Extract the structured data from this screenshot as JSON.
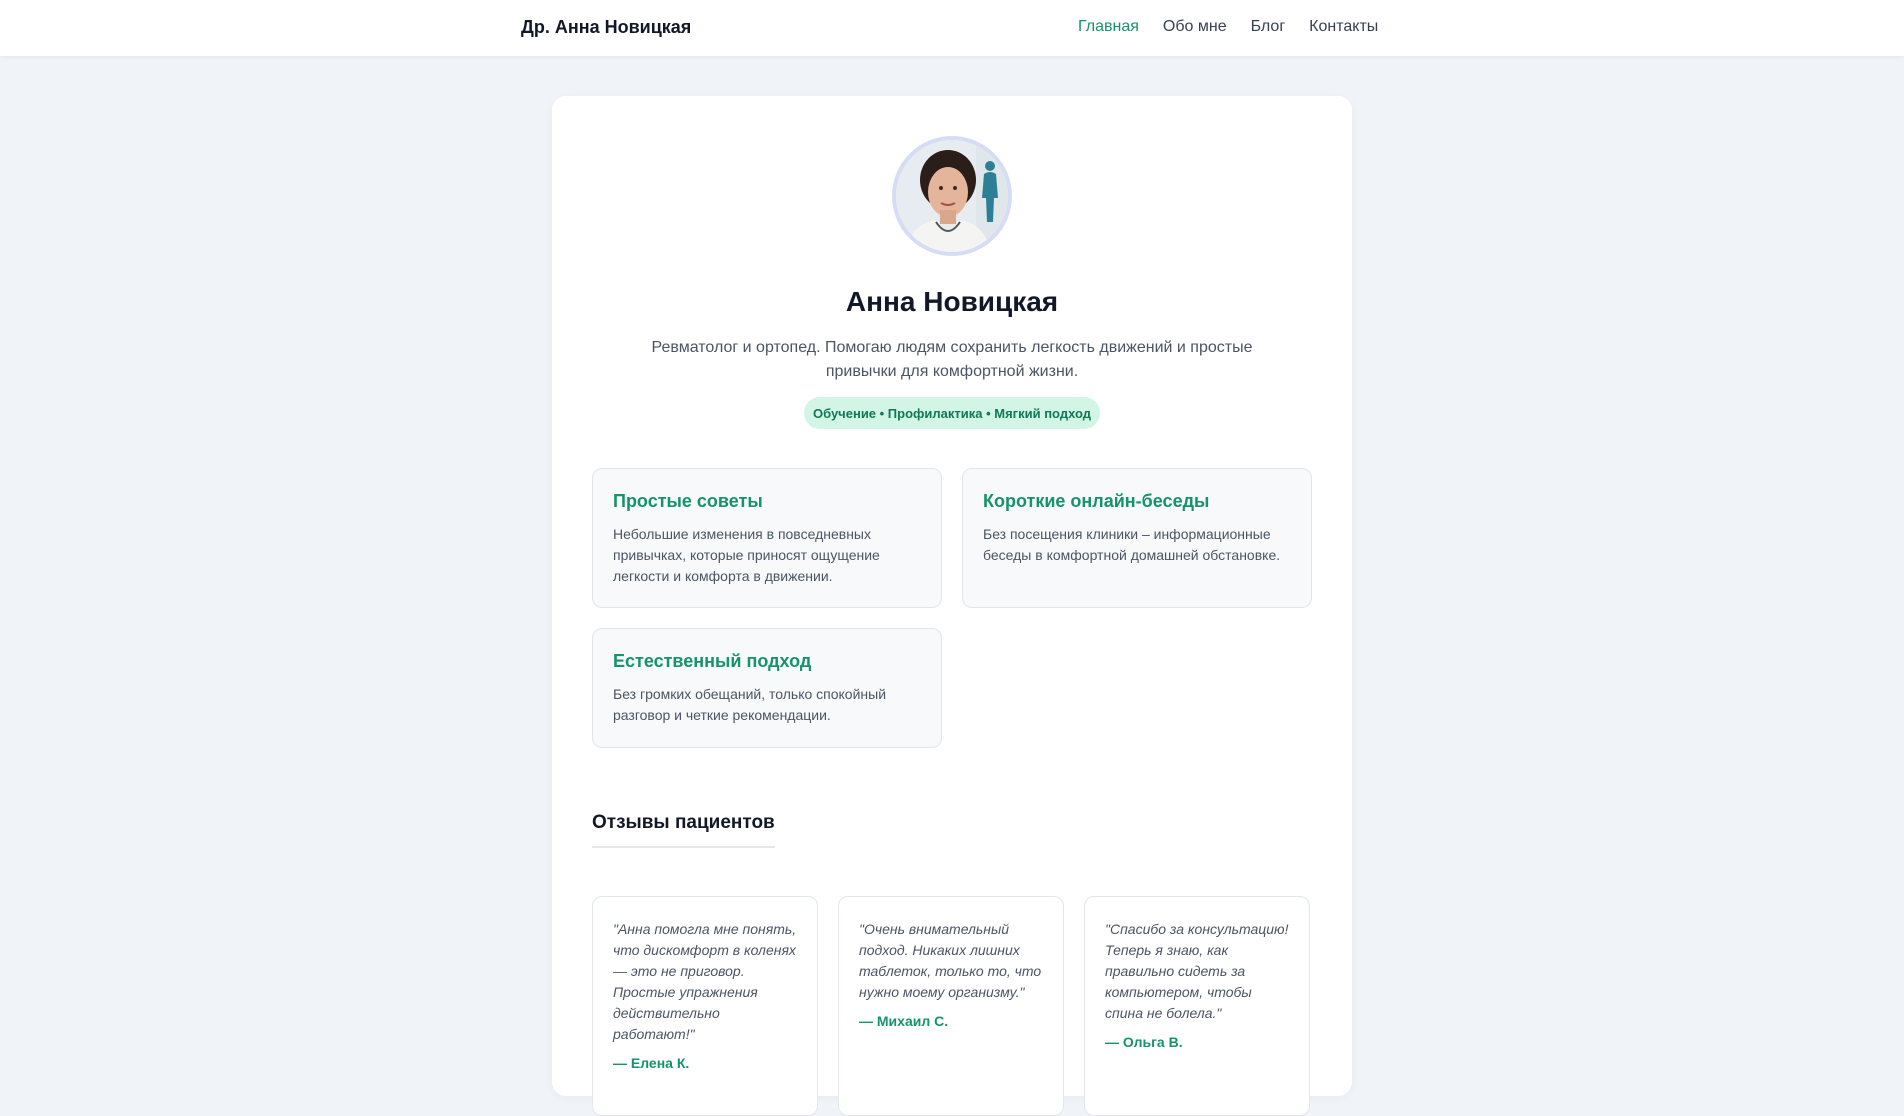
{
  "header": {
    "brand": "Др. Анна Новицкая",
    "nav": [
      {
        "label": "Главная",
        "active": true
      },
      {
        "label": "Обо мне",
        "active": false
      },
      {
        "label": "Блог",
        "active": false
      },
      {
        "label": "Контакты",
        "active": false
      }
    ]
  },
  "profile": {
    "avatar_icon": "doctor-portrait",
    "name": "Анна Новицкая",
    "bio": "Ревматолог и ортопед. Помогаю людям сохранить легкость движений и простые привычки для комфортной жизни.",
    "tags": "Обучение • Профилактика • Мягкий подход"
  },
  "features": [
    {
      "title": "Простые советы",
      "text": "Небольшие изменения в повседневных привычках, которые приносят ощущение легкости и комфорта в движении."
    },
    {
      "title": "Короткие онлайн-беседы",
      "text": "Без посещения клиники – информационные беседы в комфортной домашней обстановке."
    },
    {
      "title": "Естественный подход",
      "text": "Без громких обещаний, только спокойный разговор и четкие рекомендации."
    }
  ],
  "reviews": {
    "title": "Отзывы пациентов",
    "items": [
      {
        "quote": "\"Анна помогла мне понять, что дискомфорт в коленях — это не приговор. Простые упражнения действительно работают!\"",
        "author": "— Елена К."
      },
      {
        "quote": "\"Очень внимательный подход. Никаких лишних таблеток, только то, что нужно моему организму.\"",
        "author": "— Михаил С."
      },
      {
        "quote": "\"Спасибо за консультацию! Теперь я знаю, как правильно сидеть за компьютером, чтобы спина не болела.\"",
        "author": "— Ольга В."
      }
    ]
  },
  "colors": {
    "accent": "#15936a",
    "pill_bg": "#d2f5e6",
    "page_bg": "#f0f3f7"
  }
}
